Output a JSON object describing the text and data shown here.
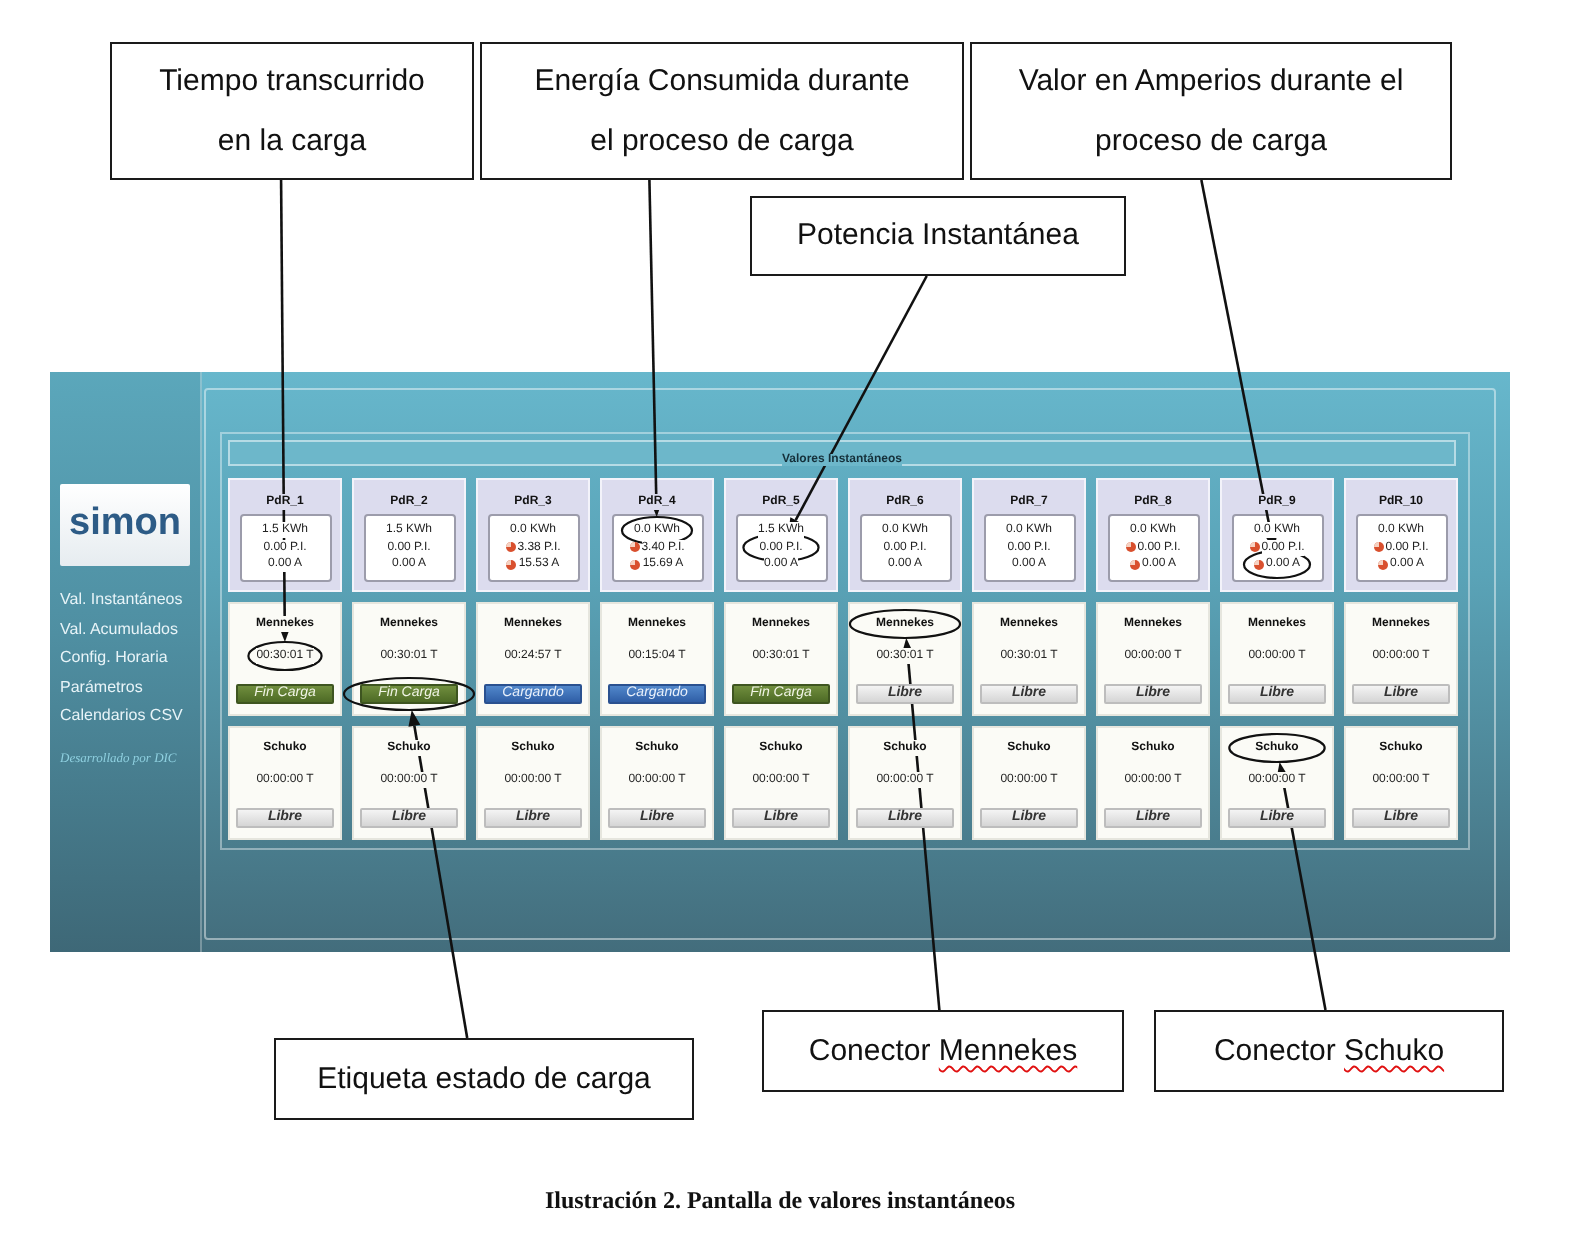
{
  "top_callouts": [
    {
      "lines": [
        "Tiempo transcurrido",
        "en la carga"
      ]
    },
    {
      "lines": [
        "Energía Consumida durante",
        "el proceso de carga"
      ]
    },
    {
      "lines": [
        "Valor en Amperios durante el",
        "proceso de carga"
      ]
    }
  ],
  "power_callout": {
    "lines": [
      "Potencia Instantánea"
    ]
  },
  "screen": {
    "logo": "simon",
    "menu": [
      "Val. Instantáneos",
      "Val. Acumulados",
      "Config. Horaria",
      "Parámetros",
      "Calendarios CSV"
    ],
    "credit": "Desarrollado por DIC",
    "panel_title": "Valores Instantáneos",
    "chargers": [
      {
        "name": "PdR_1",
        "readings": [
          {
            "text": "1.5 KWh",
            "alert": false
          },
          {
            "text": "0.00 P.I.",
            "alert": false
          },
          {
            "text": "0.00 A",
            "alert": false
          }
        ],
        "connectors": [
          {
            "name": "Mennekes",
            "time": "00:30:01 T",
            "status": {
              "label": "Fin Carga",
              "kind": "done"
            }
          },
          {
            "name": "Schuko",
            "time": "00:00:00 T",
            "status": {
              "label": "Libre",
              "kind": "free"
            }
          }
        ]
      },
      {
        "name": "PdR_2",
        "readings": [
          {
            "text": "1.5 KWh",
            "alert": false
          },
          {
            "text": "0.00 P.I.",
            "alert": false
          },
          {
            "text": "0.00 A",
            "alert": false
          }
        ],
        "connectors": [
          {
            "name": "Mennekes",
            "time": "00:30:01 T",
            "status": {
              "label": "Fin Carga",
              "kind": "done"
            }
          },
          {
            "name": "Schuko",
            "time": "00:00:00 T",
            "status": {
              "label": "Libre",
              "kind": "free"
            }
          }
        ]
      },
      {
        "name": "PdR_3",
        "readings": [
          {
            "text": "0.0 KWh",
            "alert": false
          },
          {
            "text": "3.38 P.I.",
            "alert": true
          },
          {
            "text": "15.53 A",
            "alert": true
          }
        ],
        "connectors": [
          {
            "name": "Mennekes",
            "time": "00:24:57 T",
            "status": {
              "label": "Cargando",
              "kind": "charging"
            }
          },
          {
            "name": "Schuko",
            "time": "00:00:00 T",
            "status": {
              "label": "Libre",
              "kind": "free"
            }
          }
        ]
      },
      {
        "name": "PdR_4",
        "readings": [
          {
            "text": "0.0 KWh",
            "alert": false
          },
          {
            "text": "3.40 P.I.",
            "alert": true
          },
          {
            "text": "15.69 A",
            "alert": true
          }
        ],
        "connectors": [
          {
            "name": "Mennekes",
            "time": "00:15:04 T",
            "status": {
              "label": "Cargando",
              "kind": "charging"
            }
          },
          {
            "name": "Schuko",
            "time": "00:00:00 T",
            "status": {
              "label": "Libre",
              "kind": "free"
            }
          }
        ]
      },
      {
        "name": "PdR_5",
        "readings": [
          {
            "text": "1.5 KWh",
            "alert": false
          },
          {
            "text": "0.00 P.I.",
            "alert": false
          },
          {
            "text": "0.00 A",
            "alert": false
          }
        ],
        "connectors": [
          {
            "name": "Mennekes",
            "time": "00:30:01 T",
            "status": {
              "label": "Fin Carga",
              "kind": "done"
            }
          },
          {
            "name": "Schuko",
            "time": "00:00:00 T",
            "status": {
              "label": "Libre",
              "kind": "free"
            }
          }
        ]
      },
      {
        "name": "PdR_6",
        "readings": [
          {
            "text": "0.0 KWh",
            "alert": false
          },
          {
            "text": "0.00 P.I.",
            "alert": false
          },
          {
            "text": "0.00 A",
            "alert": false
          }
        ],
        "connectors": [
          {
            "name": "Mennekes",
            "time": "00:30:01 T",
            "status": {
              "label": "Libre",
              "kind": "free"
            }
          },
          {
            "name": "Schuko",
            "time": "00:00:00 T",
            "status": {
              "label": "Libre",
              "kind": "free"
            }
          }
        ]
      },
      {
        "name": "PdR_7",
        "readings": [
          {
            "text": "0.0 KWh",
            "alert": false
          },
          {
            "text": "0.00 P.I.",
            "alert": false
          },
          {
            "text": "0.00 A",
            "alert": false
          }
        ],
        "connectors": [
          {
            "name": "Mennekes",
            "time": "00:30:01 T",
            "status": {
              "label": "Libre",
              "kind": "free"
            }
          },
          {
            "name": "Schuko",
            "time": "00:00:00 T",
            "status": {
              "label": "Libre",
              "kind": "free"
            }
          }
        ]
      },
      {
        "name": "PdR_8",
        "readings": [
          {
            "text": "0.0 KWh",
            "alert": false
          },
          {
            "text": "0.00 P.I.",
            "alert": true
          },
          {
            "text": "0.00 A",
            "alert": true
          }
        ],
        "connectors": [
          {
            "name": "Mennekes",
            "time": "00:00:00 T",
            "status": {
              "label": "Libre",
              "kind": "free"
            }
          },
          {
            "name": "Schuko",
            "time": "00:00:00 T",
            "status": {
              "label": "Libre",
              "kind": "free"
            }
          }
        ]
      },
      {
        "name": "PdR_9",
        "readings": [
          {
            "text": "0.0 KWh",
            "alert": false
          },
          {
            "text": "0.00 P.I.",
            "alert": true
          },
          {
            "text": "0.00 A",
            "alert": true
          }
        ],
        "connectors": [
          {
            "name": "Mennekes",
            "time": "00:00:00 T",
            "status": {
              "label": "Libre",
              "kind": "free"
            }
          },
          {
            "name": "Schuko",
            "time": "00:00:00 T",
            "status": {
              "label": "Libre",
              "kind": "free"
            }
          }
        ]
      },
      {
        "name": "PdR_10",
        "readings": [
          {
            "text": "0.0 KWh",
            "alert": false
          },
          {
            "text": "0.00 P.I.",
            "alert": true
          },
          {
            "text": "0.00 A",
            "alert": true
          }
        ],
        "connectors": [
          {
            "name": "Mennekes",
            "time": "00:00:00 T",
            "status": {
              "label": "Libre",
              "kind": "free"
            }
          },
          {
            "name": "Schuko",
            "time": "00:00:00 T",
            "status": {
              "label": "Libre",
              "kind": "free"
            }
          }
        ]
      }
    ]
  },
  "bottom_callouts": [
    {
      "segments": [
        {
          "text": "Etiqueta estado de carga",
          "misspelled": false
        }
      ]
    },
    {
      "segments": [
        {
          "text": "Conector",
          "misspelled": false
        },
        {
          "text": "Mennekes",
          "misspelled": true
        }
      ]
    },
    {
      "segments": [
        {
          "text": "Conector",
          "misspelled": false
        },
        {
          "text": "Schuko",
          "misspelled": true
        }
      ]
    }
  ],
  "caption": "Ilustración 2. Pantalla de valores instantáneos"
}
